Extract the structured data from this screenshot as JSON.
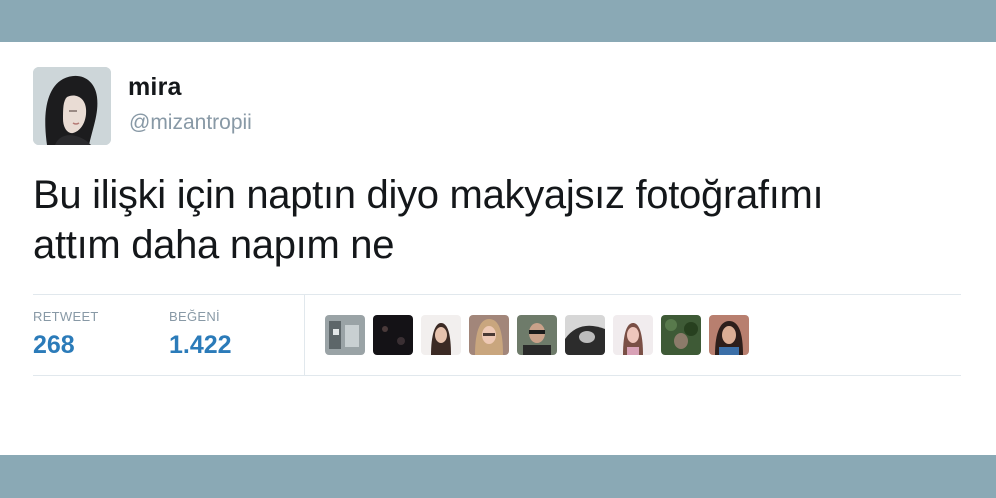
{
  "tweet": {
    "author": {
      "display_name": "mira",
      "handle": "@mizantropii",
      "avatar_icon": "user-avatar-icon"
    },
    "text_lines": [
      "Bu ilişki için naptın diyo makyajsız fotoğrafımı",
      "attım daha napım ne"
    ],
    "stats": {
      "retweet_label": "RETWEET",
      "retweet_count": "268",
      "like_label": "BEĞENİ",
      "like_count": "1.422"
    },
    "likers_count_shown": 9
  },
  "colors": {
    "band": "#8aa9b5",
    "stat_value": "#2b7bb9",
    "muted": "#8899a6",
    "text": "#14171a",
    "divider": "#e1e8ed"
  }
}
